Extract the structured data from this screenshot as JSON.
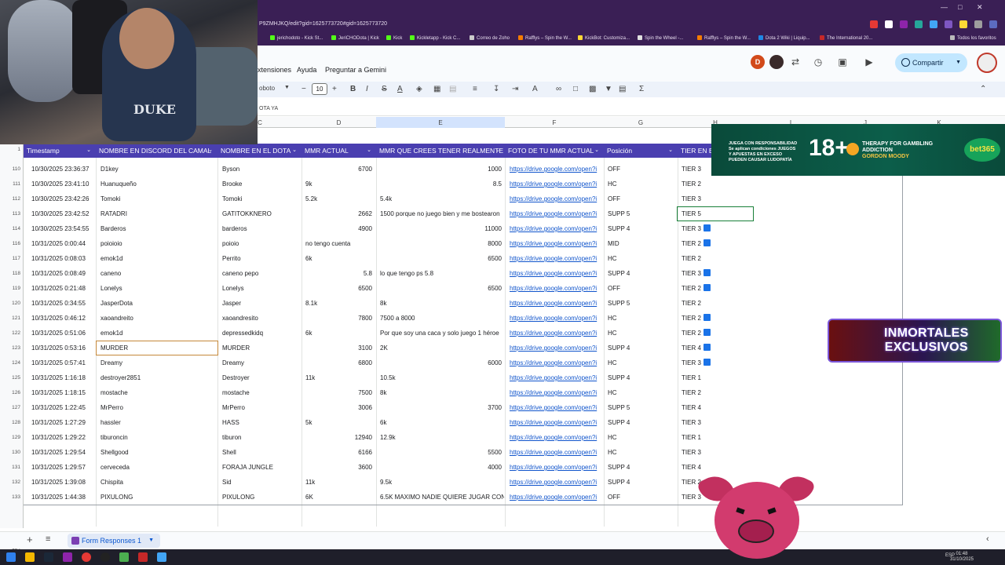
{
  "browser": {
    "url": "P9ZMHJKQ/edit?gid=1625773720#gid=1625773720",
    "bookmarks": [
      "jerichodoto - Kick St...",
      "JeriCHODota | Kick",
      "Kick",
      "Kickletapp - Kick C...",
      "Correo de Zoho",
      "Rafflys – Spin the W...",
      "KickBot: Customiza...",
      "Spin the Wheel -...",
      "Rafflys – Spin the W...",
      "Dota 2 Wiki | Liquip...",
      "The International 20...",
      "Todos los favoritos"
    ]
  },
  "menu": {
    "items": [
      "xtensiones",
      "Ayuda",
      "Preguntar a Gemini"
    ],
    "avatar_letter": "D",
    "share_label": "Compartir"
  },
  "toolbar": {
    "font_name": "oboto",
    "font_size": "10"
  },
  "formula_bar": {
    "text": "OTA YA"
  },
  "columns": [
    "C",
    "D",
    "E",
    "F",
    "G",
    "H",
    "I",
    "J",
    "K"
  ],
  "header_row": {
    "row_number": "1",
    "cells": [
      "Timestamp",
      "NOMBRE EN DISCORD DEL CAMAL",
      "NOMBRE EN EL DOTA",
      "MMR ACTUAL",
      "MMR QUE CREES TENER REALMENTE",
      "FOTO DE TU MMR ACTUAL",
      "Posición",
      "TIER EN E"
    ]
  },
  "rows": [
    {
      "n": "110",
      "ts": "10/30/2025 23:36:37",
      "discord": "D1key",
      "dota": "Byson",
      "mmr": "",
      "mmr_num": "6700",
      "real": "",
      "real_num": "1000",
      "link": "https://drive.google.com/open?i",
      "pos": "OFF",
      "tier": "TIER 3",
      "flag": false
    },
    {
      "n": "111",
      "ts": "10/30/2025 23:41:10",
      "discord": "Huanuqueño",
      "dota": "Brooke",
      "mmr": "9k",
      "mmr_num": "",
      "real": "",
      "real_num": "8.5",
      "link": "https://drive.google.com/open?i",
      "pos": "HC",
      "tier": "TIER 2",
      "flag": false
    },
    {
      "n": "112",
      "ts": "10/30/2025 23:42:26",
      "discord": "Tomoki",
      "dota": "Tomoki",
      "mmr": "5.2k",
      "mmr_num": "",
      "real": "5.4k",
      "real_num": "",
      "link": "https://drive.google.com/open?i",
      "pos": "OFF",
      "tier": "TIER 3",
      "flag": false
    },
    {
      "n": "113",
      "ts": "10/30/2025 23:42:52",
      "discord": "RATADRI",
      "dota": "GATITOKKNERO",
      "mmr": "",
      "mmr_num": "2662",
      "real": "1500 porque no juego bien y me bostearon",
      "real_num": "",
      "link": "https://drive.google.com/open?i",
      "pos": "SUPP 5",
      "tier": "TIER 5",
      "flag": false
    },
    {
      "n": "114",
      "ts": "10/30/2025 23:54:55",
      "discord": "Barderos",
      "dota": "barderos",
      "mmr": "",
      "mmr_num": "4900",
      "real": "",
      "real_num": "11000",
      "link": "https://drive.google.com/open?i",
      "pos": "SUPP 4",
      "tier": "TIER 3",
      "flag": true
    },
    {
      "n": "116",
      "ts": "10/31/2025 0:00:44",
      "discord": "poioioio",
      "dota": "poioio",
      "mmr": "no tengo cuenta",
      "mmr_num": "",
      "real": "",
      "real_num": "8000",
      "link": "https://drive.google.com/open?i",
      "pos": "MID",
      "tier": "TIER 2",
      "flag": true
    },
    {
      "n": "117",
      "ts": "10/31/2025 0:08:03",
      "discord": "emok1d",
      "dota": "Perrito",
      "mmr": "6k",
      "mmr_num": "",
      "real": "",
      "real_num": "6500",
      "link": "https://drive.google.com/open?i",
      "pos": "HC",
      "tier": "TIER 2",
      "flag": false
    },
    {
      "n": "118",
      "ts": "10/31/2025 0:08:49",
      "discord": "caneno",
      "dota": "caneno pepo",
      "mmr": "",
      "mmr_num": "5.8",
      "real": "lo que tengo ps 5.8",
      "real_num": "",
      "link": "https://drive.google.com/open?i",
      "pos": "SUPP 4",
      "tier": "TIER 3",
      "flag": true
    },
    {
      "n": "119",
      "ts": "10/31/2025 0:21:48",
      "discord": "Lonelys",
      "dota": "Lonelys",
      "mmr": "",
      "mmr_num": "6500",
      "real": "",
      "real_num": "6500",
      "link": "https://drive.google.com/open?i",
      "pos": "OFF",
      "tier": "TIER 2",
      "flag": true
    },
    {
      "n": "120",
      "ts": "10/31/2025 0:34:55",
      "discord": "JasperDota",
      "dota": "Jasper",
      "mmr": "8.1k",
      "mmr_num": "",
      "real": "8k",
      "real_num": "",
      "link": "https://drive.google.com/open?i",
      "pos": "SUPP 5",
      "tier": "TIER 2",
      "flag": false
    },
    {
      "n": "121",
      "ts": "10/31/2025 0:46:12",
      "discord": "xaoandreito",
      "dota": "xaoandresito",
      "mmr": "",
      "mmr_num": "7800",
      "real": "7500 a 8000",
      "real_num": "",
      "link": "https://drive.google.com/open?i",
      "pos": "HC",
      "tier": "TIER 2",
      "flag": true
    },
    {
      "n": "122",
      "ts": "10/31/2025 0:51:06",
      "discord": "emok1d",
      "dota": "depressedkidq",
      "mmr": "6k",
      "mmr_num": "",
      "real": "Por que soy una caca y solo juego 1 héroe",
      "real_num": "",
      "link": "https://drive.google.com/open?i",
      "pos": "HC",
      "tier": "TIER 2",
      "flag": true
    },
    {
      "n": "123",
      "ts": "10/31/2025 0:53:16",
      "discord": "MURDER",
      "dota": "MURDER",
      "mmr": "",
      "mmr_num": "3100",
      "real": "2K",
      "real_num": "",
      "link": "https://drive.google.com/open?i",
      "pos": "SUPP 4",
      "tier": "TIER 4",
      "flag": true
    },
    {
      "n": "124",
      "ts": "10/31/2025 0:57:41",
      "discord": "Dreamy",
      "dota": "Dreamy",
      "mmr": "",
      "mmr_num": "6800",
      "real": "",
      "real_num": "6000",
      "link": "https://drive.google.com/open?i",
      "pos": "HC",
      "tier": "TIER 3",
      "flag": true
    },
    {
      "n": "125",
      "ts": "10/31/2025 1:16:18",
      "discord": "destroyer2851",
      "dota": "Destroyer",
      "mmr": "11k",
      "mmr_num": "",
      "real": "10.5k",
      "real_num": "",
      "link": "https://drive.google.com/open?i",
      "pos": "SUPP 4",
      "tier": "TIER 1",
      "flag": false
    },
    {
      "n": "126",
      "ts": "10/31/2025 1:18:15",
      "discord": "mostache",
      "dota": "mostache",
      "mmr": "",
      "mmr_num": "7500",
      "real": "8k",
      "real_num": "",
      "link": "https://drive.google.com/open?i",
      "pos": "HC",
      "tier": "TIER 2",
      "flag": false
    },
    {
      "n": "127",
      "ts": "10/31/2025 1:22:45",
      "discord": "MrPerro",
      "dota": "MrPerro",
      "mmr": "",
      "mmr_num": "3006",
      "real": "",
      "real_num": "3700",
      "link": "https://drive.google.com/open?i",
      "pos": "SUPP 5",
      "tier": "TIER 4",
      "flag": false
    },
    {
      "n": "128",
      "ts": "10/31/2025 1:27:29",
      "discord": "hassler",
      "dota": "HASS",
      "mmr": "5k",
      "mmr_num": "",
      "real": "6k",
      "real_num": "",
      "link": "https://drive.google.com/open?i",
      "pos": "SUPP 4",
      "tier": "TIER 3",
      "flag": false
    },
    {
      "n": "129",
      "ts": "10/31/2025 1:29:22",
      "discord": "tiburoncin",
      "dota": "tiburon",
      "mmr": "",
      "mmr_num": "12940",
      "real": "12.9k",
      "real_num": "",
      "link": "https://drive.google.com/open?i",
      "pos": "HC",
      "tier": "TIER 1",
      "flag": false
    },
    {
      "n": "130",
      "ts": "10/31/2025 1:29:54",
      "discord": "Shellgood",
      "dota": "Shell",
      "mmr": "",
      "mmr_num": "6166",
      "real": "",
      "real_num": "5500",
      "link": "https://drive.google.com/open?i",
      "pos": "HC",
      "tier": "TIER 3",
      "flag": false
    },
    {
      "n": "131",
      "ts": "10/31/2025 1:29:57",
      "discord": "cerveceda",
      "dota": "FORAJA JUNGLE",
      "mmr": "",
      "mmr_num": "3600",
      "real": "",
      "real_num": "4000",
      "link": "https://drive.google.com/open?i",
      "pos": "SUPP 4",
      "tier": "TIER 4",
      "flag": false
    },
    {
      "n": "132",
      "ts": "10/31/2025 1:39:08",
      "discord": "Chispita",
      "dota": "Sid",
      "mmr": "11k",
      "mmr_num": "",
      "real": "9.5k",
      "real_num": "",
      "link": "https://drive.google.com/open?i",
      "pos": "SUPP 4",
      "tier": "TIER 2",
      "flag": false
    },
    {
      "n": "133",
      "ts": "10/31/2025 1:44:38",
      "discord": "PIXULONG",
      "dota": "PIXULONG",
      "mmr": "6K",
      "mmr_num": "",
      "real": "6.5K MAXIMO NADIE QUIERE JUGAR CONMIGO",
      "real_num": "",
      "link": "https://drive.google.com/open?i",
      "pos": "OFF",
      "tier": "TIER 3",
      "flag": false
    }
  ],
  "empty_rows": [
    "134",
    "135"
  ],
  "sheet_tab": {
    "label": "Form Responses 1"
  },
  "taskbar": {
    "time": "01:48",
    "date": "31/10/2025",
    "lang": "ESP"
  },
  "overlays": {
    "webcam_text": "DUKE",
    "ad_small": "JUEGA CON RESPONSABILIDAD Se aplican condiciones JUEGOS Y APUESTAS EN EXCESO PUEDEN CAUSAR LUDOPATÍA",
    "ad_age": "18+",
    "ad_therapy": "THERAPY FOR GAMBLING ADDICTION",
    "ad_gordon": "GORDON MOODY",
    "ad_brand": "bet365",
    "immortal_line1": "INMORTALES",
    "immortal_line2": "EXCLUSIVOS"
  },
  "colors": {
    "header_bg": "#4a3fb0",
    "link": "#1155cc",
    "chrome_bg": "#3a1f55",
    "share_bg": "#c2e7ff"
  }
}
